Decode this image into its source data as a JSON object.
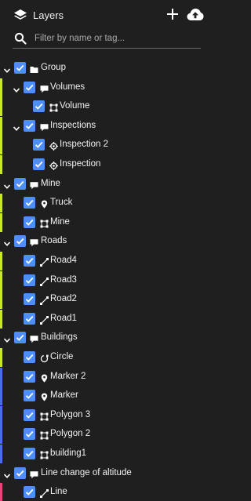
{
  "header": {
    "title": "Layers",
    "layers_icon": "layers-stack-icon",
    "add_icon": "plus-icon",
    "cloud_icon": "cloud-upload-icon"
  },
  "search": {
    "placeholder": "Filter by name or tag...",
    "value": "",
    "icon": "search-icon"
  },
  "colors": {
    "background": "#1f1f1f",
    "checkbox": "#4e8ff7",
    "bar_lime": "#c8e632",
    "bar_blue": "#4a6fe0",
    "bar_pink": "#e0457b"
  },
  "tree": {
    "rows": [
      {
        "label": "Group",
        "level": 0,
        "kind": "folder",
        "expanded": true,
        "checked": true,
        "icon": "folder-icon",
        "bar": null
      },
      {
        "label": "Volumes",
        "level": 1,
        "kind": "group",
        "expanded": true,
        "checked": true,
        "icon": "comment-icon",
        "bar": "lime"
      },
      {
        "label": "Volume",
        "level": 2,
        "kind": "item",
        "checked": true,
        "icon": "polygon-icon",
        "bar": "lime"
      },
      {
        "label": "Inspections",
        "level": 1,
        "kind": "group",
        "expanded": true,
        "checked": true,
        "icon": "comment-icon",
        "bar": "lime"
      },
      {
        "label": "Inspection 2",
        "level": 2,
        "kind": "item",
        "checked": true,
        "icon": "target-icon",
        "bar": "lime"
      },
      {
        "label": "Inspection",
        "level": 2,
        "kind": "item",
        "checked": true,
        "icon": "target-icon",
        "bar": "lime"
      },
      {
        "label": "Mine",
        "level": 0,
        "kind": "group",
        "expanded": true,
        "checked": true,
        "icon": "comment-icon",
        "bar": null
      },
      {
        "label": "Truck",
        "level": 1,
        "kind": "item",
        "checked": true,
        "icon": "pin-icon",
        "bar": "lime"
      },
      {
        "label": "Mine",
        "level": 1,
        "kind": "item",
        "checked": true,
        "icon": "polygon-icon",
        "bar": "lime"
      },
      {
        "label": "Roads",
        "level": 0,
        "kind": "group",
        "expanded": true,
        "checked": true,
        "icon": "comment-icon",
        "bar": null
      },
      {
        "label": "Road4",
        "level": 1,
        "kind": "item",
        "checked": true,
        "icon": "line-icon",
        "bar": "lime"
      },
      {
        "label": "Road3",
        "level": 1,
        "kind": "item",
        "checked": true,
        "icon": "line-icon",
        "bar": "lime"
      },
      {
        "label": "Road2",
        "level": 1,
        "kind": "item",
        "checked": true,
        "icon": "line-icon",
        "bar": "lime"
      },
      {
        "label": "Road1",
        "level": 1,
        "kind": "item",
        "checked": true,
        "icon": "line-icon",
        "bar": "lime"
      },
      {
        "label": "Buildings",
        "level": 0,
        "kind": "group",
        "expanded": true,
        "checked": true,
        "icon": "comment-icon",
        "bar": null
      },
      {
        "label": "Circle",
        "level": 1,
        "kind": "item",
        "checked": true,
        "icon": "circle-icon",
        "bar": "lime"
      },
      {
        "label": "Marker 2",
        "level": 1,
        "kind": "item",
        "checked": true,
        "icon": "pin-icon",
        "bar": "blue"
      },
      {
        "label": "Marker",
        "level": 1,
        "kind": "item",
        "checked": true,
        "icon": "pin-icon",
        "bar": "blue"
      },
      {
        "label": "Polygon 3",
        "level": 1,
        "kind": "item",
        "checked": true,
        "icon": "polygon-icon",
        "bar": "blue"
      },
      {
        "label": "Polygon 2",
        "level": 1,
        "kind": "item",
        "checked": true,
        "icon": "polygon-icon",
        "bar": "blue"
      },
      {
        "label": "building1",
        "level": 1,
        "kind": "item",
        "checked": true,
        "icon": "polygon-icon",
        "bar": "blue"
      },
      {
        "label": "Line change of altitude",
        "level": 0,
        "kind": "group",
        "expanded": true,
        "checked": true,
        "icon": "comment-icon",
        "bar": null
      },
      {
        "label": "Line",
        "level": 1,
        "kind": "item",
        "checked": true,
        "icon": "line-icon",
        "bar": "pink"
      }
    ]
  }
}
